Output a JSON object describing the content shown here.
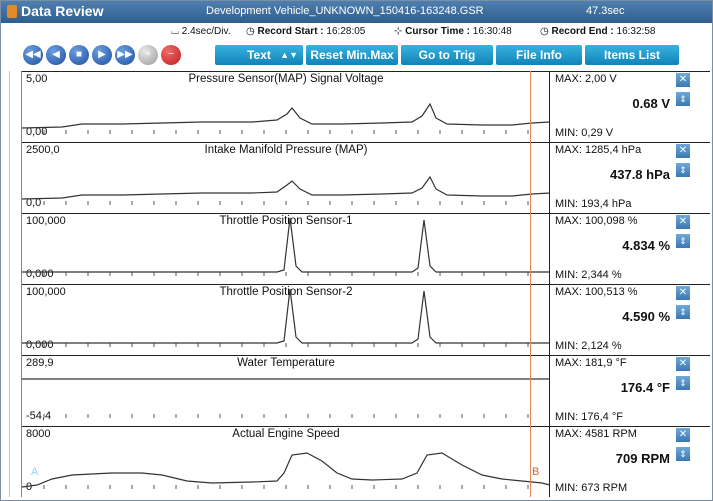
{
  "window": {
    "title": "Data Review",
    "file": "Development Vehicle_UNKNOWN_150416-163248.GSR",
    "duration": "47.3sec"
  },
  "info": {
    "div": "2.4sec/Div.",
    "record_start_label": "Record Start :",
    "record_start": "16:28:05",
    "cursor_time_label": "Cursor Time :",
    "cursor_time": "16:30:48",
    "record_end_label": "Record End :",
    "record_end": "16:32:58"
  },
  "toolbar": {
    "rewind_icon": "◀◀",
    "prev_icon": "◀",
    "stop_icon": "■",
    "play_icon": "▶",
    "fast_forward_icon": "▶▶",
    "add_icon": "+",
    "remove_icon": "−",
    "text_label": "Text",
    "text_arrows": "▲▼",
    "reset_label": "Reset Min.Max",
    "trig_label": "Go to Trig",
    "fileinfo_label": "File Info",
    "items_label": "Items List"
  },
  "cursors": {
    "a": "A",
    "b": "B"
  },
  "panels": [
    {
      "title": "Pressure Sensor(MAP) Signal Voltage",
      "ymax": "5,00",
      "ymin": "0,00",
      "max": "MAX:  2,00 V",
      "value": "0.68 V",
      "min": "MIN:  0,29 V"
    },
    {
      "title": "Intake Manifold Pressure (MAP)",
      "ymax": "2500,0",
      "ymin": "0,0",
      "max": "MAX: 1285,4 hPa",
      "value": "437.8 hPa",
      "min": "MIN: 193,4 hPa"
    },
    {
      "title": "Throttle Position Sensor-1",
      "ymax": "100,000",
      "ymin": "0,000",
      "max": "MAX: 100,098 %",
      "value": "4.834 %",
      "min": "MIN: 2,344 %"
    },
    {
      "title": "Throttle Position Sensor-2",
      "ymax": "100,000",
      "ymin": "0,000",
      "max": "MAX: 100,513 %",
      "value": "4.590 %",
      "min": "MIN: 2,124 %"
    },
    {
      "title": "Water Temperature",
      "ymax": "289,9",
      "ymin": "-54,4",
      "max": "MAX: 181,9 °F",
      "value": "176.4 °F",
      "min": "MIN: 176,4 °F"
    },
    {
      "title": "Actual Engine Speed",
      "ymax": "8000",
      "ymin": "0",
      "max": "MAX:  4581 RPM",
      "value": "709 RPM",
      "min": "MIN:   673 RPM"
    }
  ],
  "side_icons": {
    "close": "✕",
    "scale": "⇕"
  },
  "colors": {
    "titlebar": "#2f5e8e",
    "button": "#1282b8",
    "cursor_a": "#8fd8e8",
    "cursor_b": "#e05a2a",
    "trace": "#333333"
  }
}
